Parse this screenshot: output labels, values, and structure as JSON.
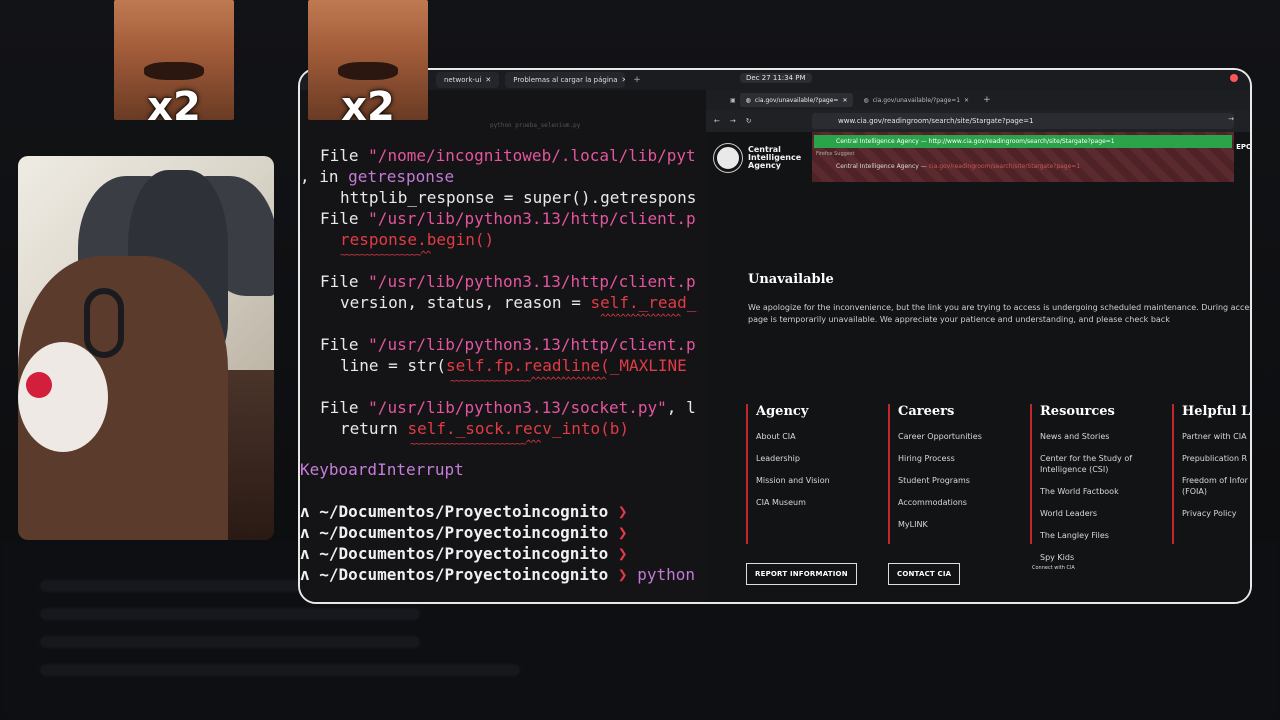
{
  "topbar": {
    "tab1": "network-ui",
    "tab2": "Problemas al cargar la página",
    "clock": "Dec 27  11:34 PM",
    "ghost_title": "python prueba_selenium.py"
  },
  "terminal": {
    "l1_a": "File ",
    "l1_b": "\"/nome/incognitoweb/.local/lib/pyt",
    "l2_a": ", in ",
    "l2_b": "getresponse",
    "l3": "httplib_response = super().getrespons",
    "l4_a": "File ",
    "l4_b": "\"/usr/lib/python3.13/http/client.p",
    "l5": "response.begin()",
    "s1": "~~~~~~~~~~~~~~~~^^",
    "l6_a": "File ",
    "l6_b": "\"/usr/lib/python3.13/http/client.p",
    "l7_a": "version, status, reason = ",
    "l7_b": "self._read_",
    "s2": "^^^^^^^^^^^^^^^^",
    "l8_a": "File ",
    "l8_b": "\"/usr/lib/python3.13/http/client.p",
    "l9_a": "line = str(",
    "l9_b": "self.fp.readline(_MAXLINE",
    "s3": "~~~~~~~~~~~~~~~~^^^^^^^^^^^^^^^",
    "l10_a": "File ",
    "l10_b": "\"/usr/lib/python3.13/socket.py\"",
    "l10_c": ", l",
    "l11_a": "return ",
    "l11_b": "self._sock.recv_into(b)",
    "s4": "~~~~~~~~~~~~~~~~~~~~~~~^^^",
    "kbi": "KeyboardInterrupt",
    "prompt": "~/Documentos/Proyectoincognito",
    "caret": "❯",
    "tri": "ʌ",
    "cmd": "python"
  },
  "browser": {
    "tab1": "cia.gov/unavailable/?page=",
    "tab2": "cia.gov/unavailable/?page=1",
    "url": "www.cia.gov/readingroom/search/site/Stargate?page=1",
    "dd1_title": "Central Intelligence Agency",
    "dd1_url": "http://www.cia.gov/readingroom/search/site/Stargate?page=1",
    "dd_label": "Firefox Suggest",
    "dd2_title": "Central Intelligence Agency",
    "dd2_url": "cia.gov/readingroom/search/site/Stargate?page=1",
    "cia_l1": "Central",
    "cia_l2": "Intelligence",
    "cia_l3": "Agency",
    "epo": "EPO",
    "unavailable_title": "Unavailable",
    "unavailable_text": "We apologize for the inconvenience, but the link you are trying to access is undergoing scheduled maintenance. During access to the page is temporarily unavailable. We appreciate your patience and understanding, and please check back",
    "footer": {
      "agency": {
        "title": "Agency",
        "links": [
          "About CIA",
          "Leadership",
          "Mission and Vision",
          "CIA Museum"
        ]
      },
      "careers": {
        "title": "Careers",
        "links": [
          "Career Opportunities",
          "Hiring Process",
          "Student Programs",
          "Accommodations",
          "MyLINK"
        ]
      },
      "resources": {
        "title": "Resources",
        "links": [
          "News and Stories",
          "Center for the Study of Intelligence (CSI)",
          "The World Factbook",
          "World Leaders",
          "The Langley Files",
          "Spy Kids"
        ]
      },
      "helpful": {
        "title": "Helpful Lin",
        "links": [
          "Partner with CIA",
          "Prepublication R",
          "Freedom of Infor (FOIA)",
          "Privacy Policy"
        ]
      },
      "report_btn": "REPORT INFORMATION",
      "contact_btn": "CONTACT CIA",
      "connect": "Connect with CIA"
    }
  },
  "overlay": {
    "x2_a": "x2",
    "x2_b": "x2"
  }
}
